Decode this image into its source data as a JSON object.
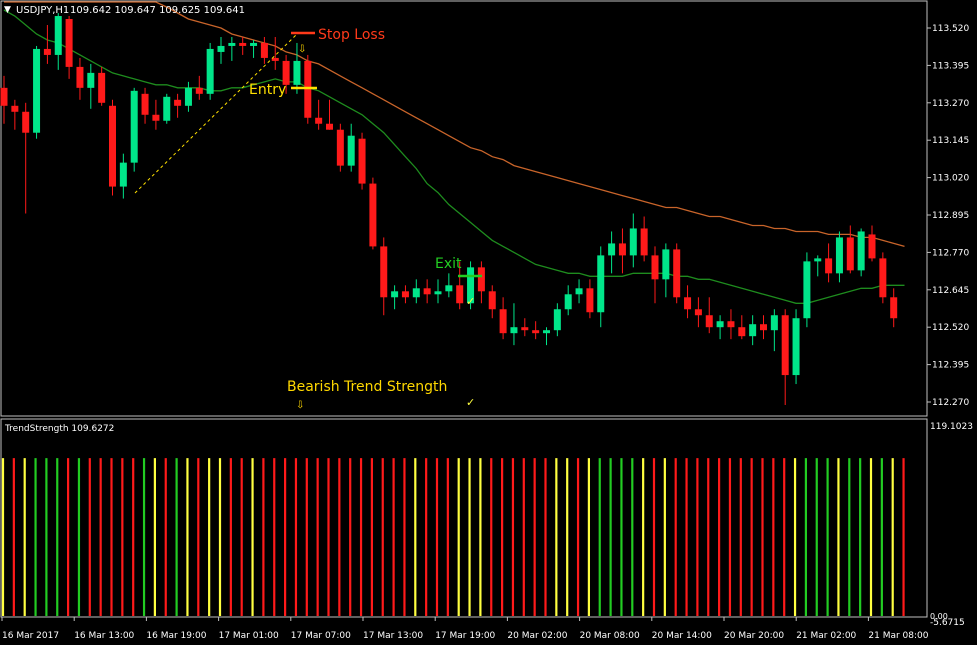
{
  "header": {
    "symbol_label": "USDJPY,H1",
    "ohlc_label": "109.642 109.647 109.625 109.641"
  },
  "indicator": {
    "label": "TrendStrength 109.6272",
    "scale_top": "119.1023",
    "scale_bottom": "0.00",
    "scale_bottom2": "-5.6715"
  },
  "annotations": {
    "stop_loss": "Stop Loss",
    "entry": "Entry",
    "exit": "Exit",
    "bearish": "Bearish Trend Strength"
  },
  "colors": {
    "background": "#000000",
    "bull": "#00e68a",
    "bear": "#ff1a1a",
    "fast_ma": "#1e8c1e",
    "slow_ma": "#c8642a",
    "stop_loss": "#ff3a1a",
    "entry": "#ffe000",
    "exit": "#22cc22",
    "yellow": "#ffff40",
    "text": "#ffffff",
    "grid": "#c0c0c0"
  },
  "chart_data": [
    {
      "type": "candlestick",
      "symbol": "USDJPY,H1",
      "yticks": [
        113.52,
        113.395,
        113.27,
        113.145,
        113.02,
        112.895,
        112.77,
        112.645,
        112.52,
        112.395,
        112.27
      ],
      "ylim": [
        112.2,
        113.6
      ],
      "xticks": [
        "16 Mar 2017",
        "16 Mar 13:00",
        "16 Mar 19:00",
        "17 Mar 01:00",
        "17 Mar 07:00",
        "17 Mar 13:00",
        "17 Mar 19:00",
        "20 Mar 02:00",
        "20 Mar 08:00",
        "20 Mar 14:00",
        "20 Mar 20:00",
        "21 Mar 02:00",
        "21 Mar 08:00"
      ],
      "candles": [
        [
          113.32,
          113.36,
          113.2,
          113.26
        ],
        [
          113.26,
          113.28,
          113.18,
          113.24
        ],
        [
          113.24,
          113.27,
          112.9,
          113.17
        ],
        [
          113.17,
          113.46,
          113.15,
          113.45
        ],
        [
          113.45,
          113.53,
          113.4,
          113.43
        ],
        [
          113.43,
          113.57,
          113.38,
          113.56
        ],
        [
          113.55,
          113.56,
          113.35,
          113.39
        ],
        [
          113.39,
          113.42,
          113.28,
          113.32
        ],
        [
          113.32,
          113.4,
          113.25,
          113.37
        ],
        [
          113.37,
          113.39,
          113.26,
          113.27
        ],
        [
          113.26,
          113.28,
          112.96,
          112.99
        ],
        [
          112.99,
          113.1,
          112.95,
          113.07
        ],
        [
          113.07,
          113.32,
          113.04,
          113.31
        ],
        [
          113.3,
          113.32,
          113.2,
          113.23
        ],
        [
          113.23,
          113.28,
          113.18,
          113.21
        ],
        [
          113.21,
          113.3,
          113.2,
          113.29
        ],
        [
          113.28,
          113.3,
          113.22,
          113.26
        ],
        [
          113.26,
          113.34,
          113.24,
          113.32
        ],
        [
          113.32,
          113.36,
          113.28,
          113.3
        ],
        [
          113.3,
          113.47,
          113.28,
          113.45
        ],
        [
          113.44,
          113.49,
          113.4,
          113.46
        ],
        [
          113.46,
          113.49,
          113.41,
          113.47
        ],
        [
          113.47,
          113.49,
          113.43,
          113.46
        ],
        [
          113.46,
          113.48,
          113.42,
          113.47
        ],
        [
          113.47,
          113.49,
          113.4,
          113.42
        ],
        [
          113.42,
          113.49,
          113.38,
          113.41
        ],
        [
          113.41,
          113.43,
          113.3,
          113.33
        ],
        [
          113.33,
          113.47,
          113.3,
          113.41
        ],
        [
          113.41,
          113.43,
          113.2,
          113.22
        ],
        [
          113.22,
          113.28,
          113.18,
          113.2
        ],
        [
          113.2,
          113.28,
          113.18,
          113.18
        ],
        [
          113.18,
          113.2,
          113.04,
          113.06
        ],
        [
          113.06,
          113.2,
          113.04,
          113.16
        ],
        [
          113.15,
          113.17,
          112.98,
          113.0
        ],
        [
          113.0,
          113.02,
          112.78,
          112.79
        ],
        [
          112.79,
          112.82,
          112.56,
          112.62
        ],
        [
          112.62,
          112.66,
          112.58,
          112.64
        ],
        [
          112.64,
          112.66,
          112.6,
          112.62
        ],
        [
          112.62,
          112.68,
          112.6,
          112.65
        ],
        [
          112.65,
          112.68,
          112.6,
          112.63
        ],
        [
          112.63,
          112.68,
          112.6,
          112.64
        ],
        [
          112.64,
          112.7,
          112.62,
          112.66
        ],
        [
          112.66,
          112.74,
          112.58,
          112.6
        ],
        [
          112.6,
          112.74,
          112.58,
          112.72
        ],
        [
          112.72,
          112.74,
          112.6,
          112.64
        ],
        [
          112.64,
          112.66,
          112.55,
          112.58
        ],
        [
          112.58,
          112.62,
          112.48,
          112.5
        ],
        [
          112.5,
          112.6,
          112.46,
          112.52
        ],
        [
          112.52,
          112.55,
          112.49,
          112.51
        ],
        [
          112.51,
          112.54,
          112.48,
          112.5
        ],
        [
          112.5,
          112.52,
          112.46,
          112.51
        ],
        [
          112.51,
          112.6,
          112.49,
          112.58
        ],
        [
          112.58,
          112.66,
          112.56,
          112.63
        ],
        [
          112.63,
          112.68,
          112.6,
          112.65
        ],
        [
          112.65,
          112.68,
          112.55,
          112.57
        ],
        [
          112.57,
          112.79,
          112.52,
          112.76
        ],
        [
          112.76,
          112.84,
          112.7,
          112.8
        ],
        [
          112.8,
          112.85,
          112.7,
          112.76
        ],
        [
          112.76,
          112.9,
          112.72,
          112.85
        ],
        [
          112.85,
          112.89,
          112.74,
          112.76
        ],
        [
          112.76,
          112.79,
          112.6,
          112.68
        ],
        [
          112.68,
          112.8,
          112.62,
          112.78
        ],
        [
          112.78,
          112.8,
          112.6,
          112.62
        ],
        [
          112.62,
          112.66,
          112.55,
          112.58
        ],
        [
          112.58,
          112.62,
          112.52,
          112.56
        ],
        [
          112.56,
          112.62,
          112.5,
          112.52
        ],
        [
          112.52,
          112.56,
          112.48,
          112.54
        ],
        [
          112.54,
          112.58,
          112.48,
          112.52
        ],
        [
          112.52,
          112.56,
          112.48,
          112.49
        ],
        [
          112.49,
          112.56,
          112.46,
          112.53
        ],
        [
          112.53,
          112.56,
          112.48,
          112.51
        ],
        [
          112.51,
          112.58,
          112.44,
          112.56
        ],
        [
          112.56,
          112.58,
          112.26,
          112.36
        ],
        [
          112.36,
          112.58,
          112.33,
          112.55
        ],
        [
          112.55,
          112.77,
          112.52,
          112.74
        ],
        [
          112.74,
          112.76,
          112.69,
          112.75
        ],
        [
          112.75,
          112.8,
          112.67,
          112.7
        ],
        [
          112.7,
          112.84,
          112.67,
          112.82
        ],
        [
          112.82,
          112.86,
          112.7,
          112.71
        ],
        [
          112.71,
          112.85,
          112.69,
          112.84
        ],
        [
          112.83,
          112.86,
          112.74,
          112.75
        ],
        [
          112.75,
          112.77,
          112.6,
          112.62
        ],
        [
          112.62,
          112.65,
          112.52,
          112.55
        ]
      ],
      "fast_ma": [
        113.58,
        113.56,
        113.53,
        113.5,
        113.48,
        113.47,
        113.45,
        113.43,
        113.41,
        113.39,
        113.37,
        113.36,
        113.35,
        113.34,
        113.33,
        113.33,
        113.32,
        113.32,
        113.32,
        113.31,
        113.31,
        113.32,
        113.32,
        113.33,
        113.34,
        113.35,
        113.34,
        113.34,
        113.32,
        113.31,
        113.29,
        113.27,
        113.25,
        113.23,
        113.2,
        113.17,
        113.13,
        113.09,
        113.05,
        113.0,
        112.97,
        112.93,
        112.9,
        112.87,
        112.84,
        112.81,
        112.79,
        112.77,
        112.75,
        112.73,
        112.72,
        112.71,
        112.7,
        112.7,
        112.69,
        112.69,
        112.69,
        112.69,
        112.7,
        112.7,
        112.7,
        112.7,
        112.69,
        112.69,
        112.68,
        112.68,
        112.67,
        112.66,
        112.65,
        112.64,
        112.63,
        112.62,
        112.61,
        112.6,
        112.6,
        112.61,
        112.62,
        112.63,
        112.64,
        112.65,
        112.65,
        112.66,
        112.66,
        112.66
      ],
      "slow_ma": [
        113.99,
        113.96,
        113.93,
        113.9,
        113.87,
        113.84,
        113.81,
        113.78,
        113.75,
        113.72,
        113.7,
        113.67,
        113.65,
        113.63,
        113.61,
        113.59,
        113.57,
        113.55,
        113.54,
        113.53,
        113.52,
        113.5,
        113.49,
        113.48,
        113.47,
        113.46,
        113.44,
        113.43,
        113.41,
        113.4,
        113.38,
        113.36,
        113.34,
        113.32,
        113.3,
        113.28,
        113.26,
        113.24,
        113.22,
        113.2,
        113.18,
        113.16,
        113.14,
        113.12,
        113.11,
        113.09,
        113.08,
        113.06,
        113.05,
        113.04,
        113.03,
        113.02,
        113.01,
        113.0,
        112.99,
        112.98,
        112.97,
        112.96,
        112.95,
        112.94,
        112.93,
        112.92,
        112.92,
        112.91,
        112.9,
        112.89,
        112.89,
        112.88,
        112.87,
        112.86,
        112.86,
        112.85,
        112.85,
        112.84,
        112.84,
        112.84,
        112.83,
        112.83,
        112.83,
        112.82,
        112.82,
        112.81,
        112.8,
        112.79
      ]
    },
    {
      "type": "histogram",
      "name": "TrendStrength",
      "ylim": [
        0,
        119.1023
      ],
      "values": [
        100,
        100,
        100,
        100,
        100,
        100,
        100,
        100,
        100,
        100,
        100,
        100,
        100,
        100,
        100,
        100,
        100,
        100,
        100,
        100,
        100,
        100,
        100,
        100,
        100,
        100,
        100,
        100,
        100,
        100,
        100,
        100,
        100,
        100,
        100,
        100,
        100,
        100,
        100,
        100,
        100,
        100,
        100,
        100,
        100,
        100,
        100,
        100,
        100,
        100,
        100,
        100,
        100,
        100,
        100,
        100,
        100,
        100,
        100,
        100,
        100,
        100,
        100,
        100,
        100,
        100,
        100,
        100,
        100,
        100,
        100,
        100,
        100,
        100,
        100,
        100,
        100,
        100,
        100,
        100,
        100,
        100,
        100,
        100
      ],
      "colors": [
        "y",
        "r",
        "y",
        "g",
        "g",
        "g",
        "r",
        "g",
        "r",
        "r",
        "r",
        "r",
        "r",
        "g",
        "y",
        "r",
        "g",
        "y",
        "r",
        "y",
        "y",
        "r",
        "r",
        "y",
        "r",
        "r",
        "r",
        "r",
        "r",
        "r",
        "r",
        "r",
        "r",
        "r",
        "r",
        "r",
        "r",
        "r",
        "y",
        "r",
        "r",
        "r",
        "y",
        "y",
        "y",
        "r",
        "r",
        "r",
        "r",
        "r",
        "r",
        "y",
        "y",
        "r",
        "y",
        "g",
        "g",
        "g",
        "g",
        "y",
        "r",
        "y",
        "r",
        "r",
        "r",
        "r",
        "r",
        "r",
        "r",
        "r",
        "r",
        "r",
        "r",
        "y",
        "g",
        "g",
        "g",
        "y",
        "g",
        "g",
        "y",
        "g",
        "y",
        "r"
      ]
    }
  ]
}
